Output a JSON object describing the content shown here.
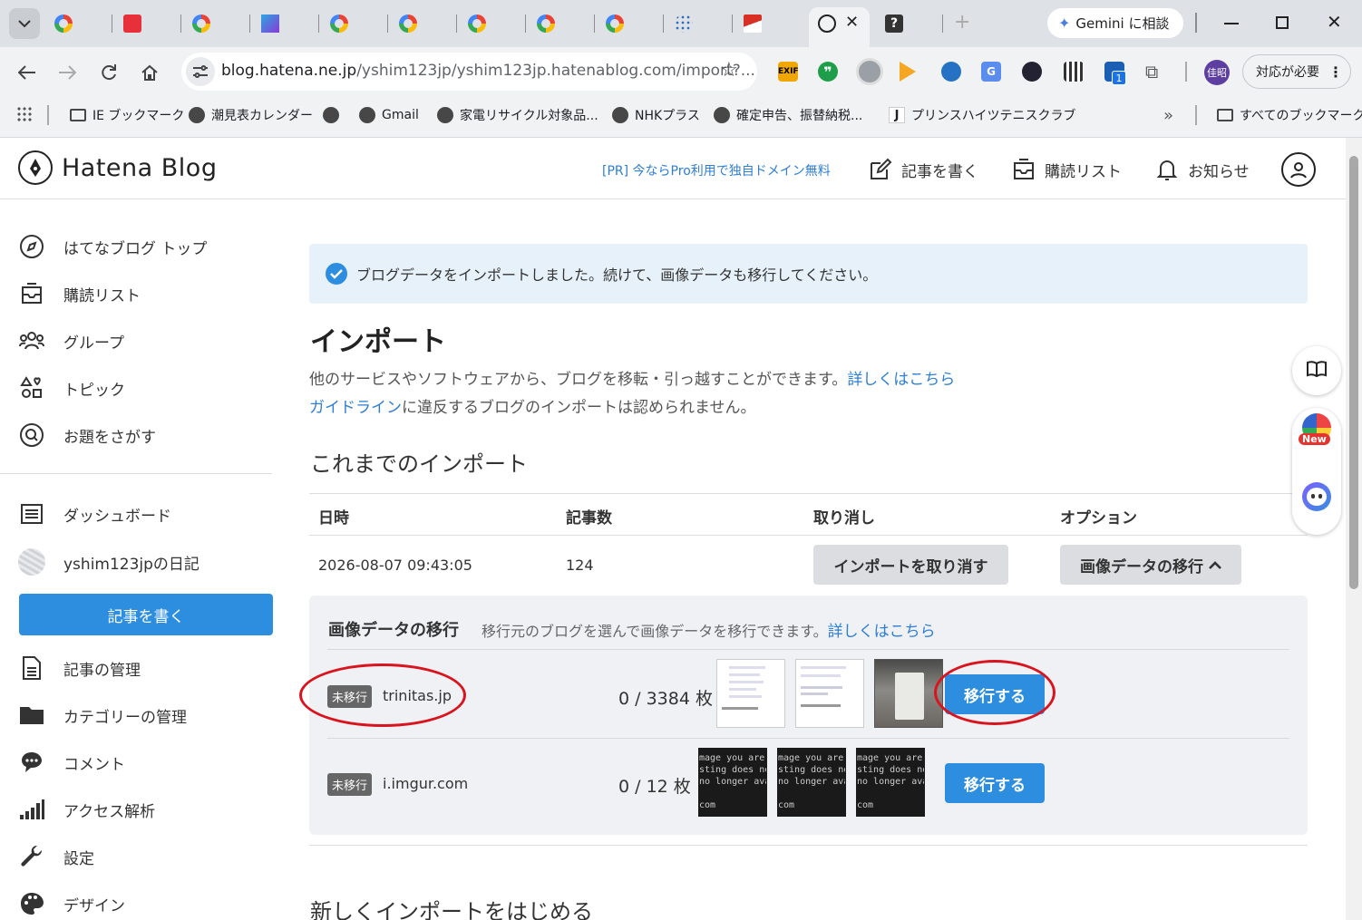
{
  "browser": {
    "gemini_label": "Gemini に相談",
    "url_host": "blog.hatena.ne.jp",
    "url_path": "/yshim123jp/yshim123jp.hatenablog.com/import?...",
    "profile_initials": "佳昭",
    "action_label": "対応が必要",
    "ext_badge": "1",
    "bookmarks": [
      "IE ブックマーク",
      "潮見表カレンダー",
      "",
      "Gmail",
      "家電リサイクル対象品...",
      "NHKプラス",
      "確定申告、振替納税...",
      "プリンスハイツテニスクラブ"
    ],
    "all_bookmarks": "すべてのブックマーク",
    "overflow": "»"
  },
  "header": {
    "logo": "Hatena Blog",
    "promo": "[PR] 今ならPro利用で独自ドメイン無料",
    "write": "記事を書く",
    "reading_list": "購読リスト",
    "notifications": "お知らせ"
  },
  "sidebar": {
    "top_items": [
      "はてなブログ トップ",
      "購読リスト",
      "グループ",
      "トピック",
      "お題をさがす"
    ],
    "dashboard": "ダッシュボード",
    "blog_name": "yshim123jpの日記",
    "write_button": "記事を書く",
    "manage_items": [
      "記事の管理",
      "カテゴリーの管理",
      "コメント",
      "アクセス解析",
      "設定",
      "デザイン"
    ]
  },
  "notice": "ブログデータをインポートしました。続けて、画像データも移行してください。",
  "main": {
    "title": "インポート",
    "desc_1": "他のサービスやソフトウェアから、ブログを移転・引っ越すことができます。",
    "desc_1_link": "詳しくはこちら",
    "desc_2_link": "ガイドライン",
    "desc_2": "に違反するブログのインポートは認められません。",
    "history_title": "これまでのインポート",
    "columns": [
      "日時",
      "記事数",
      "取り消し",
      "オプション"
    ],
    "row": {
      "datetime": "2026-08-07 09:43:05",
      "count": "124",
      "cancel_button": "インポートを取り消す",
      "option_button": "画像データの移行"
    },
    "image_panel": {
      "title": "画像データの移行",
      "desc": "移行元のブログを選んで画像データを移行できます。",
      "link": "詳しくはこちら",
      "sources": [
        {
          "badge": "未移行",
          "domain": "trinitas.jp",
          "count": "0 / 3384 枚",
          "button": "移行する"
        },
        {
          "badge": "未移行",
          "domain": "i.imgur.com",
          "count": "0 / 12 枚",
          "button": "移行する"
        }
      ],
      "imgur_thumb_lines": [
        "mage you are",
        "sting does no",
        "no longer avail",
        "",
        "com"
      ]
    },
    "new_import_title": "新しくインポートをはじめる"
  },
  "floating": {
    "new_badge": "New"
  }
}
